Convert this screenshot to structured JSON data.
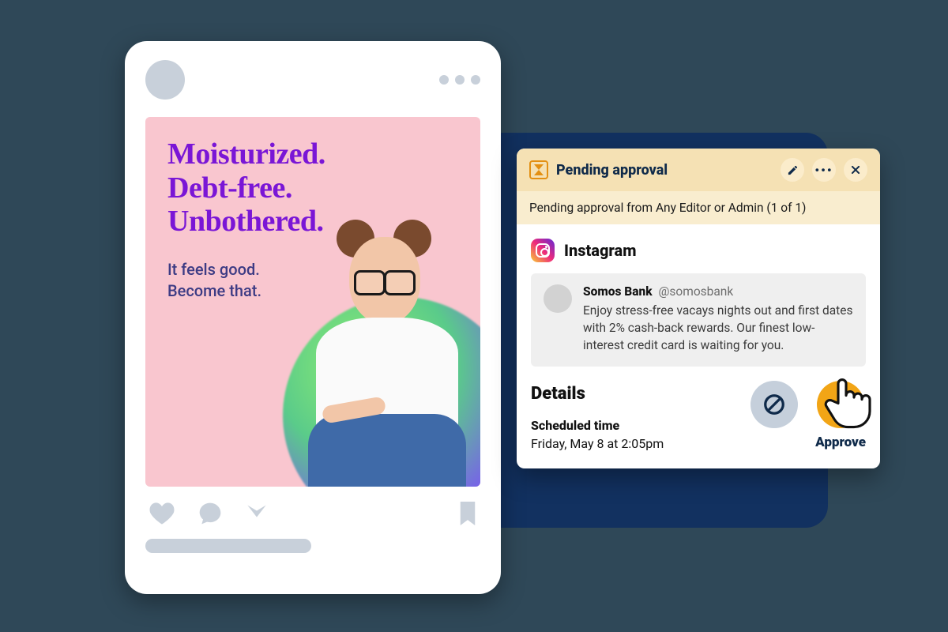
{
  "post": {
    "headline_line1": "Moisturized.",
    "headline_line2": "Debt-free.",
    "headline_line3": "Unbothered.",
    "sub_line1": "It feels good.",
    "sub_line2": "Become that."
  },
  "approval": {
    "title": "Pending approval",
    "sub": "Pending approval from Any Editor or Admin (1 of 1)",
    "network": "Instagram",
    "account_name": "Somos Bank",
    "account_handle": "@somosbank",
    "caption": "Enjoy stress-free vacays nights out and first dates with 2% cash-back rewards. Our finest low-interest credit card is waiting for you.",
    "details_heading": "Details",
    "scheduled_label": "Scheduled time",
    "scheduled_value": "Friday, May 8 at 2:05pm",
    "approve_label": "Approve"
  }
}
